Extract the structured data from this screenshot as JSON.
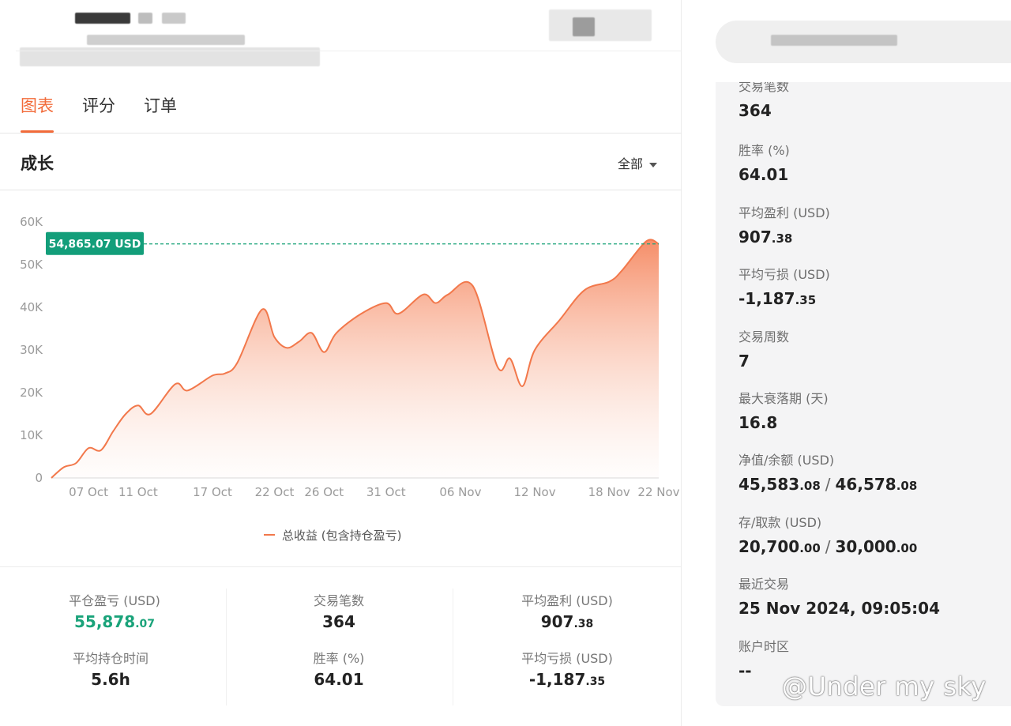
{
  "tabs": [
    "图表",
    "评分",
    "订单"
  ],
  "growth": {
    "title": "成长",
    "filter": "全部"
  },
  "chart_data": {
    "type": "area",
    "title": "",
    "xlabel": "",
    "ylabel": "",
    "ylim": [
      0,
      60000
    ],
    "yticks": [
      "0",
      "10K",
      "20K",
      "30K",
      "40K",
      "50K",
      "60K"
    ],
    "xticks": [
      "07 Oct",
      "11 Oct",
      "17 Oct",
      "22 Oct",
      "26 Oct",
      "31 Oct",
      "06 Nov",
      "12 Nov",
      "18 Nov",
      "22 Nov"
    ],
    "current_value_label": "54,865.07 USD",
    "current_value": 54865.07,
    "legend_position": "bottom-center",
    "series": [
      {
        "name": "总收益 (包含持仓盈亏)",
        "color": "#f2784b",
        "points": [
          [
            "04 Oct",
            0
          ],
          [
            "05 Oct",
            2500
          ],
          [
            "06 Oct",
            3500
          ],
          [
            "07 Oct",
            7000
          ],
          [
            "08 Oct",
            6500
          ],
          [
            "09 Oct",
            11000
          ],
          [
            "10 Oct",
            15000
          ],
          [
            "11 Oct",
            17000
          ],
          [
            "12 Oct",
            15000
          ],
          [
            "14 Oct",
            22000
          ],
          [
            "15 Oct",
            20500
          ],
          [
            "17 Oct",
            24000
          ],
          [
            "18 Oct",
            24500
          ],
          [
            "19 Oct",
            27000
          ],
          [
            "21 Oct",
            39500
          ],
          [
            "22 Oct",
            33000
          ],
          [
            "23 Oct",
            30500
          ],
          [
            "24 Oct",
            32000
          ],
          [
            "25 Oct",
            34000
          ],
          [
            "26 Oct",
            29500
          ],
          [
            "27 Oct",
            34000
          ],
          [
            "29 Oct",
            38500
          ],
          [
            "31 Oct",
            41000
          ],
          [
            "01 Nov",
            38500
          ],
          [
            "03 Nov",
            43000
          ],
          [
            "04 Nov",
            41000
          ],
          [
            "05 Nov",
            43000
          ],
          [
            "07 Nov",
            45000
          ],
          [
            "09 Nov",
            26000
          ],
          [
            "10 Nov",
            28000
          ],
          [
            "11 Nov",
            21500
          ],
          [
            "12 Nov",
            30000
          ],
          [
            "14 Nov",
            37000
          ],
          [
            "16 Nov",
            44000
          ],
          [
            "18 Nov",
            46000
          ],
          [
            "19 Nov",
            48500
          ],
          [
            "21 Nov",
            55500
          ],
          [
            "22 Nov",
            54865.07
          ]
        ]
      }
    ]
  },
  "stats": [
    {
      "label": "平仓盈亏 (USD)",
      "int": "55,878",
      "dec": ".07",
      "highlight": true
    },
    {
      "label": "交易笔数",
      "int": "364",
      "dec": ""
    },
    {
      "label": "平均盈利 (USD)",
      "int": "907",
      "dec": ".38"
    },
    {
      "label": "平均持仓时间",
      "int": "5.6h",
      "dec": ""
    },
    {
      "label": "胜率 (%)",
      "int": "64.01",
      "dec": ""
    },
    {
      "label": "平均亏损 (USD)",
      "int": "-1,187",
      "dec": ".35"
    }
  ],
  "side": {
    "top_partial_label": "交易笔数",
    "items": [
      {
        "label": "胜率 (%)",
        "value": "64.01"
      },
      {
        "label": "平均盈利 (USD)",
        "value": "907",
        "dec": ".38"
      },
      {
        "label": "平均亏损 (USD)",
        "value": "-1,187",
        "dec": ".35"
      },
      {
        "label": "交易周数",
        "value": "7"
      },
      {
        "label": "最大衰落期 (天)",
        "value": "16.8"
      },
      {
        "label": "净值/余额 (USD)",
        "value": "45,583",
        "dec": ".08",
        "value2": "46,578",
        "dec2": ".08"
      },
      {
        "label": "存/取款 (USD)",
        "value": "20,700",
        "dec": ".00",
        "value2": "30,000",
        "dec2": ".00"
      },
      {
        "label": "最近交易",
        "value": "25 Nov 2024, 09:05:04"
      },
      {
        "label": "账户时区",
        "value": "--"
      }
    ],
    "top_value": "364"
  },
  "watermark": "@Under my sky"
}
